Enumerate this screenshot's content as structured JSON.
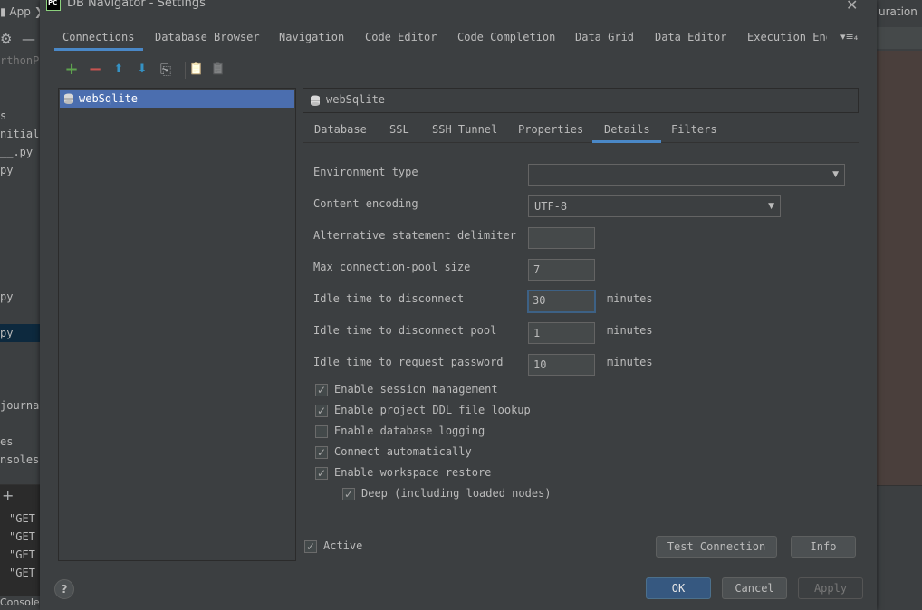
{
  "ide": {
    "app_crumb": "App",
    "project_label": "rthonPr",
    "tree_items": [
      "s",
      "nitial.",
      "__.py",
      "py",
      "py",
      "py",
      "journal",
      "es",
      "nsoles"
    ],
    "log_lines": [
      "\"GET",
      "\"GET",
      "\"GET",
      "\"GET"
    ],
    "console_tab": "Console",
    "right_label": "uration"
  },
  "dialog": {
    "icon_text": "PC",
    "title": "DB Navigator - Settings",
    "top_tabs": [
      {
        "label": "Connections"
      },
      {
        "label": "Database Browser"
      },
      {
        "label": "Navigation"
      },
      {
        "label": "Code Editor"
      },
      {
        "label": "Code Completion"
      },
      {
        "label": "Data Grid"
      },
      {
        "label": "Data Editor"
      },
      {
        "label": "Execution Eng"
      }
    ],
    "overflow_label": "▾≡₄",
    "toolbar": {
      "add_icon": "+",
      "remove_icon": "−",
      "up_icon": "⬆",
      "down_icon": "⬇",
      "copy_icon": "⎘",
      "paste_icon": "📋",
      "paste_disabled_icon": "📋"
    },
    "connections": [
      {
        "name": "webSqlite"
      }
    ],
    "detail_title": "webSqlite",
    "sub_tabs": [
      {
        "label": "Database"
      },
      {
        "label": "SSL"
      },
      {
        "label": "SSH Tunnel"
      },
      {
        "label": "Properties"
      },
      {
        "label": "Details"
      },
      {
        "label": "Filters"
      }
    ],
    "fields": {
      "environment_type": {
        "label": "Environment type",
        "value": ""
      },
      "content_encoding": {
        "label": "Content encoding",
        "value": "UTF-8"
      },
      "alt_delimiter": {
        "label": "Alternative statement delimiter",
        "value": ""
      },
      "max_pool": {
        "label": "Max connection-pool size",
        "value": "7"
      },
      "idle_disconnect": {
        "label": "Idle time to disconnect",
        "value": "30",
        "unit": "minutes"
      },
      "idle_disconnect_pool": {
        "label": "Idle time to disconnect pool",
        "value": "1",
        "unit": "minutes"
      },
      "idle_password": {
        "label": "Idle time to request password",
        "value": "10",
        "unit": "minutes"
      }
    },
    "checkboxes": {
      "session_mgmt": {
        "label": "Enable session management",
        "checked": true
      },
      "ddl_lookup": {
        "label": "Enable project DDL file lookup",
        "checked": true
      },
      "db_logging": {
        "label": "Enable database logging",
        "checked": false
      },
      "connect_auto": {
        "label": "Connect automatically",
        "checked": true
      },
      "workspace_restore": {
        "label": "Enable workspace restore",
        "checked": true
      },
      "deep": {
        "label": "Deep (including loaded nodes)",
        "checked": true
      },
      "active": {
        "label": "Active",
        "checked": true
      }
    },
    "buttons": {
      "test_connection": "Test Connection",
      "info": "Info",
      "ok": "OK",
      "cancel": "Cancel",
      "apply": "Apply",
      "help": "?"
    }
  },
  "colors": {
    "accent": "#4a88c7",
    "selection": "#4b6eaf",
    "primary_button": "#365880",
    "add_icon": "#5ea34e",
    "remove_icon": "#c75450",
    "arrow_icon": "#3592c4"
  }
}
